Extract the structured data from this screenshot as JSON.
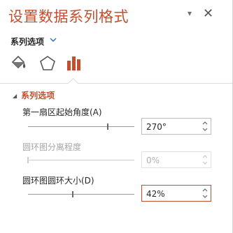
{
  "pane": {
    "title": "设置数据系列格式",
    "pin_glyph": "▾",
    "close_glyph": "✕"
  },
  "options": {
    "label": "系列选项"
  },
  "tabs": [
    {
      "name": "fill-line-icon",
      "active": false
    },
    {
      "name": "effects-icon",
      "active": false
    },
    {
      "name": "series-options-icon",
      "active": true
    }
  ],
  "section": {
    "title": "系列选项"
  },
  "fields": {
    "first_slice_angle": {
      "label": "第一扇区起始角度(A)",
      "value": "270°",
      "fraction": 0.75
    },
    "doughnut_explosion": {
      "label": "圆环图分离程度",
      "value": "0%",
      "fraction": 0.0,
      "disabled": true
    },
    "doughnut_hole_size": {
      "label": "圆环图圆环大小(D)",
      "value": "42%",
      "fraction": 0.42
    }
  },
  "colors": {
    "accent": "#c34f2f",
    "border": "#bdbdbd"
  }
}
